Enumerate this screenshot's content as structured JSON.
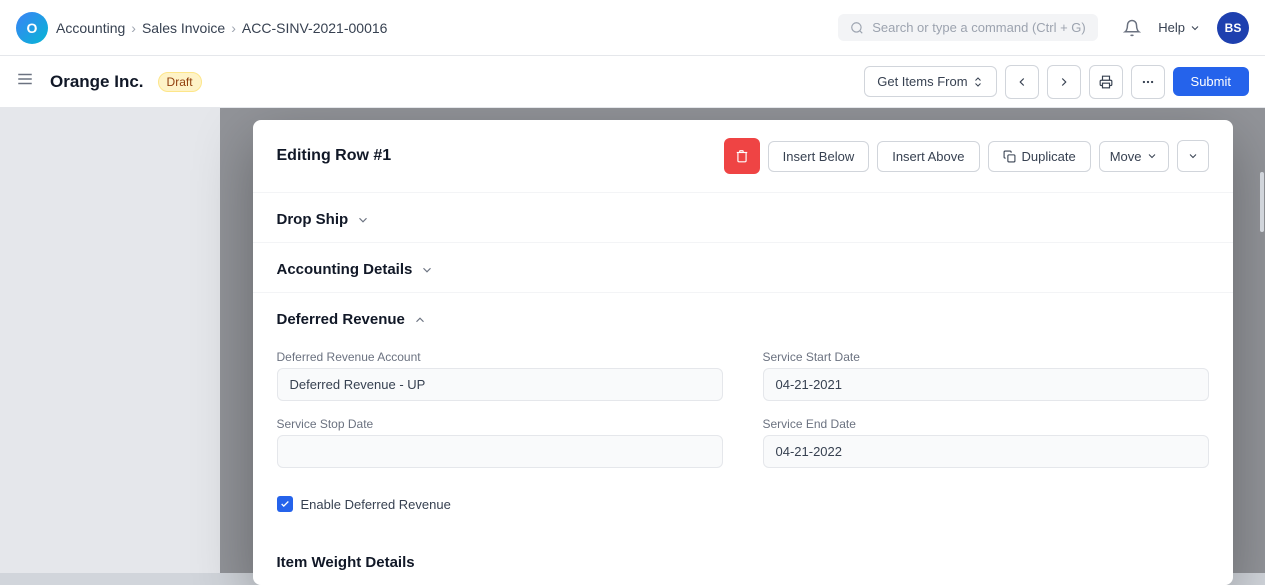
{
  "app": {
    "logo_text": "O",
    "breadcrumb": {
      "items": [
        "Accounting",
        "Sales Invoice",
        "ACC-SINV-2021-00016"
      ]
    },
    "search_placeholder": "Search or type a command (Ctrl + G)",
    "help_label": "Help",
    "avatar_initials": "BS"
  },
  "toolbar": {
    "doc_title": "Orange Inc.",
    "status": "Draft",
    "get_items_label": "Get Items From",
    "submit_label": "Submit"
  },
  "modal": {
    "title": "Editing Row #1",
    "delete_icon": "🗑",
    "insert_below_label": "Insert Below",
    "insert_above_label": "Insert Above",
    "duplicate_icon": "⧉",
    "duplicate_label": "Duplicate",
    "move_label": "Move",
    "sections": {
      "drop_ship": {
        "title": "Drop Ship",
        "expanded": false
      },
      "accounting_details": {
        "title": "Accounting Details",
        "expanded": false
      },
      "deferred_revenue": {
        "title": "Deferred Revenue",
        "expanded": true,
        "fields": {
          "deferred_revenue_account_label": "Deferred Revenue Account",
          "deferred_revenue_account_value": "Deferred Revenue - UP",
          "service_start_date_label": "Service Start Date",
          "service_start_date_value": "04-21-2021",
          "service_stop_date_label": "Service Stop Date",
          "service_stop_date_value": "",
          "service_end_date_label": "Service End Date",
          "service_end_date_value": "04-21-2022",
          "enable_deferred_revenue_label": "Enable Deferred Revenue",
          "enable_deferred_revenue_checked": true
        }
      },
      "item_weight_details": {
        "title": "Item Weight Details"
      }
    }
  }
}
